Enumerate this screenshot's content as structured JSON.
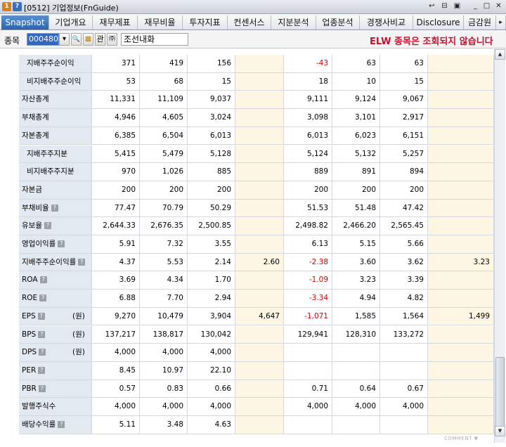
{
  "window": {
    "title": "[0512] 기업정보(FnGuide)",
    "badge1": "1",
    "badge2": "?",
    "controls": [
      "↩",
      "⊟",
      "▣",
      "_",
      "□",
      "✕"
    ]
  },
  "tabs": [
    "Snapshot",
    "기업개요",
    "재무제표",
    "재무비율",
    "투자지표",
    "컨센서스",
    "지분분석",
    "업종분석",
    "경쟁사비교",
    "Disclosure",
    "금감원"
  ],
  "toolbar": {
    "label": "종목",
    "code": "000480",
    "dropdown": "▾",
    "search": "🔍",
    "btn_a": "▦",
    "btn_gwan": "관",
    "btn_sound": "㈜",
    "company": "조선내화",
    "notice": "ELW 종목은 조회되지 않습니다"
  },
  "colors": {
    "accent": "#2d64ad",
    "negative": "#d00000",
    "highlight": "#fdf6e3",
    "label_bg": "#e3e9f1",
    "notice": "#c8102e"
  },
  "table": {
    "rows": [
      {
        "label": "지배주주순이익",
        "indent": true,
        "icon": false,
        "unit": "",
        "values": [
          "371",
          "419",
          "156",
          "",
          "-43",
          "63",
          "63",
          ""
        ]
      },
      {
        "label": "비지배주주순이익",
        "indent": true,
        "icon": false,
        "unit": "",
        "values": [
          "53",
          "68",
          "15",
          "",
          "18",
          "10",
          "15",
          ""
        ]
      },
      {
        "label": "자산총계",
        "indent": false,
        "icon": false,
        "unit": "",
        "values": [
          "11,331",
          "11,109",
          "9,037",
          "",
          "9,111",
          "9,124",
          "9,067",
          ""
        ]
      },
      {
        "label": "부채총계",
        "indent": false,
        "icon": false,
        "unit": "",
        "values": [
          "4,946",
          "4,605",
          "3,024",
          "",
          "3,098",
          "3,101",
          "2,917",
          ""
        ]
      },
      {
        "label": "자본총계",
        "indent": false,
        "icon": false,
        "unit": "",
        "values": [
          "6,385",
          "6,504",
          "6,013",
          "",
          "6,013",
          "6,023",
          "6,151",
          ""
        ]
      },
      {
        "label": "지배주주지분",
        "indent": true,
        "icon": false,
        "unit": "",
        "values": [
          "5,415",
          "5,479",
          "5,128",
          "",
          "5,124",
          "5,132",
          "5,257",
          ""
        ]
      },
      {
        "label": "비지배주주지분",
        "indent": true,
        "icon": false,
        "unit": "",
        "values": [
          "970",
          "1,026",
          "885",
          "",
          "889",
          "891",
          "894",
          ""
        ]
      },
      {
        "label": "자본금",
        "indent": false,
        "icon": false,
        "unit": "",
        "values": [
          "200",
          "200",
          "200",
          "",
          "200",
          "200",
          "200",
          ""
        ]
      },
      {
        "label": "부채비율",
        "indent": false,
        "icon": true,
        "unit": "",
        "values": [
          "77.47",
          "70.79",
          "50.29",
          "",
          "51.53",
          "51.48",
          "47.42",
          ""
        ]
      },
      {
        "label": "유보율",
        "indent": false,
        "icon": true,
        "unit": "",
        "values": [
          "2,644.33",
          "2,676.35",
          "2,500.85",
          "",
          "2,498.82",
          "2,466.20",
          "2,565.45",
          ""
        ]
      },
      {
        "label": "영업이익률",
        "indent": false,
        "icon": true,
        "unit": "",
        "values": [
          "5.91",
          "7.32",
          "3.55",
          "",
          "6.13",
          "5.15",
          "5.66",
          ""
        ]
      },
      {
        "label": "지배주주순이익률",
        "indent": false,
        "icon": true,
        "unit": "",
        "values": [
          "4.37",
          "5.53",
          "2.14",
          "2.60",
          "-2.38",
          "3.60",
          "3.62",
          "3.23"
        ]
      },
      {
        "label": "ROA",
        "indent": false,
        "icon": true,
        "unit": "",
        "values": [
          "3.69",
          "4.34",
          "1.70",
          "",
          "-1.09",
          "3.23",
          "3.39",
          ""
        ]
      },
      {
        "label": "ROE",
        "indent": false,
        "icon": true,
        "unit": "",
        "values": [
          "6.88",
          "7.70",
          "2.94",
          "",
          "-3.34",
          "4.94",
          "4.82",
          ""
        ]
      },
      {
        "label": "EPS",
        "indent": false,
        "icon": true,
        "unit": "(원)",
        "values": [
          "9,270",
          "10,479",
          "3,904",
          "4,647",
          "-1,071",
          "1,585",
          "1,564",
          "1,499"
        ]
      },
      {
        "label": "BPS",
        "indent": false,
        "icon": true,
        "unit": "(원)",
        "values": [
          "137,217",
          "138,817",
          "130,042",
          "",
          "129,941",
          "128,310",
          "133,272",
          ""
        ]
      },
      {
        "label": "DPS",
        "indent": false,
        "icon": true,
        "unit": "(원)",
        "values": [
          "4,000",
          "4,000",
          "4,000",
          "",
          "",
          "",
          "",
          ""
        ]
      },
      {
        "label": "PER",
        "indent": false,
        "icon": true,
        "unit": "",
        "values": [
          "8.45",
          "10.97",
          "22.10",
          "",
          "",
          "",
          "",
          ""
        ]
      },
      {
        "label": "PBR",
        "indent": false,
        "icon": true,
        "unit": "",
        "values": [
          "0.57",
          "0.83",
          "0.66",
          "",
          "0.71",
          "0.64",
          "0.67",
          ""
        ]
      },
      {
        "label": "발행주식수",
        "indent": false,
        "icon": false,
        "unit": "",
        "values": [
          "4,000",
          "4,000",
          "4,000",
          "",
          "4,000",
          "4,000",
          "4,000",
          ""
        ]
      },
      {
        "label": "배당수익률",
        "indent": false,
        "icon": true,
        "unit": "",
        "values": [
          "5.11",
          "3.48",
          "4.63",
          "",
          "",
          "",
          "",
          ""
        ]
      }
    ]
  },
  "footer_mark": "COMMENT ▼"
}
